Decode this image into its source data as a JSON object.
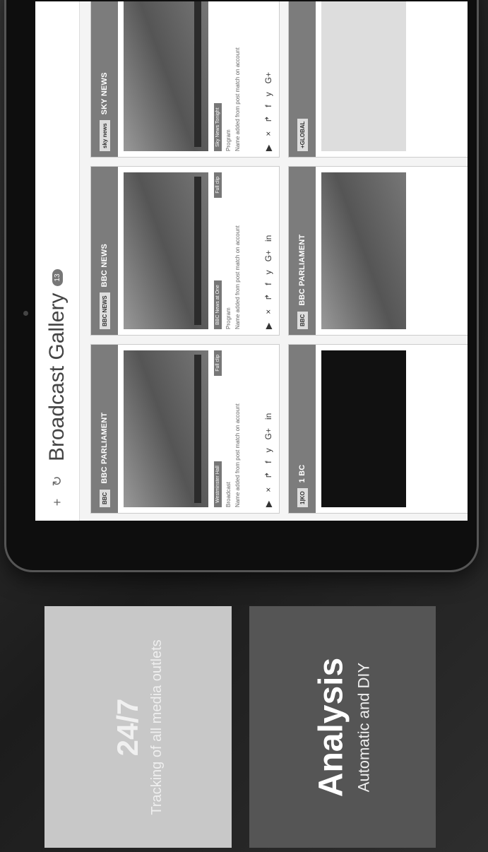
{
  "app": {
    "title": "Broadcast Gallery",
    "badge": "13"
  },
  "toolbar": {
    "add_icon": "plus-icon",
    "refresh_icon": "refresh-icon"
  },
  "cards": [
    {
      "channel": "BBC PARLIAMENT",
      "logo": "BBC",
      "tag_left": "Westminster Hall",
      "tag_right": "Full clip",
      "meta_1": "Broadcast",
      "meta_2": "Name added from post match on account"
    },
    {
      "channel": "BBC NEWS",
      "logo": "BBC NEWS",
      "tag_left": "BBC News at One",
      "tag_right": "Full clip",
      "meta_1": "Program",
      "meta_2": "Name added from post match on account"
    },
    {
      "channel": "SKY NEWS",
      "logo": "sky news",
      "tag_left": "Sky News Tonight",
      "tag_right": "",
      "meta_1": "Program",
      "meta_2": "Name added from post match on account"
    },
    {
      "channel": "1 BC",
      "logo": "1|KO",
      "tag_left": "",
      "tag_right": "",
      "meta_1": "",
      "meta_2": ""
    },
    {
      "channel": "BBC PARLIAMENT",
      "logo": "BBC",
      "tag_left": "",
      "tag_right": "",
      "meta_1": "",
      "meta_2": ""
    },
    {
      "channel": "",
      "logo": "+GLOBAL",
      "tag_left": "",
      "tag_right": "",
      "meta_1": "",
      "meta_2": ""
    }
  ],
  "share_icons": [
    "play-icon",
    "x-icon",
    "retweet-icon",
    "facebook-icon",
    "twitter-icon",
    "google-plus-icon",
    "linkedin-icon"
  ],
  "promo": {
    "tracking": {
      "headline": "24/7",
      "text": "Tracking of all media outlets"
    },
    "analysis": {
      "headline": "Analysis",
      "text": "Automatic and DIY"
    }
  }
}
